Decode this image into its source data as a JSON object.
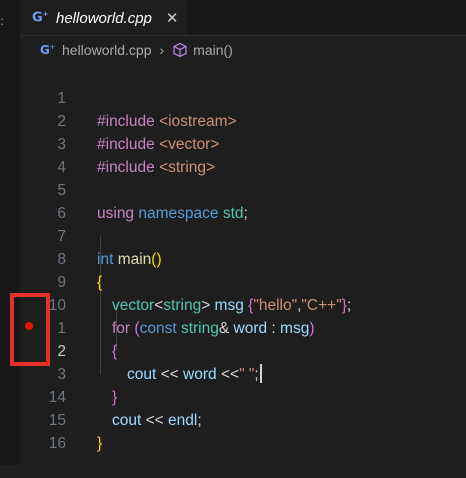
{
  "tab": {
    "icon": "cpp-icon",
    "label": "helloworld.cpp",
    "close_glyph": "✕"
  },
  "breadcrumb": {
    "file": "helloworld.cpp",
    "separator": "›",
    "symbol": "main()",
    "symbol_icon": "cube-icon"
  },
  "editor": {
    "lines": [
      {
        "number": "1",
        "text": "#include <iostream>"
      },
      {
        "number": "2",
        "text": "#include <vector>"
      },
      {
        "number": "3",
        "text": "#include <string>"
      },
      {
        "number": "4",
        "text": ""
      },
      {
        "number": "5",
        "text": "using namespace std;"
      },
      {
        "number": "6",
        "text": ""
      },
      {
        "number": "7",
        "text": "int main()"
      },
      {
        "number": "8",
        "text": "{"
      },
      {
        "number": "9",
        "text": "vector<string> msg {\"hello\",\"C++\"};"
      },
      {
        "number": "10",
        "text": "for (const string& word : msg)"
      },
      {
        "number": "1",
        "text": "{"
      },
      {
        "number": "2",
        "text": "cout << word <<\" \";"
      },
      {
        "number": "3",
        "text": "}"
      },
      {
        "number": "14",
        "text": "cout << endl;"
      },
      {
        "number": "15",
        "text": "}"
      },
      {
        "number": "16",
        "text": ""
      }
    ],
    "breakpoint_line": "12",
    "breakpoint_color": "#e51400",
    "highlight_color": "#e8302a"
  }
}
